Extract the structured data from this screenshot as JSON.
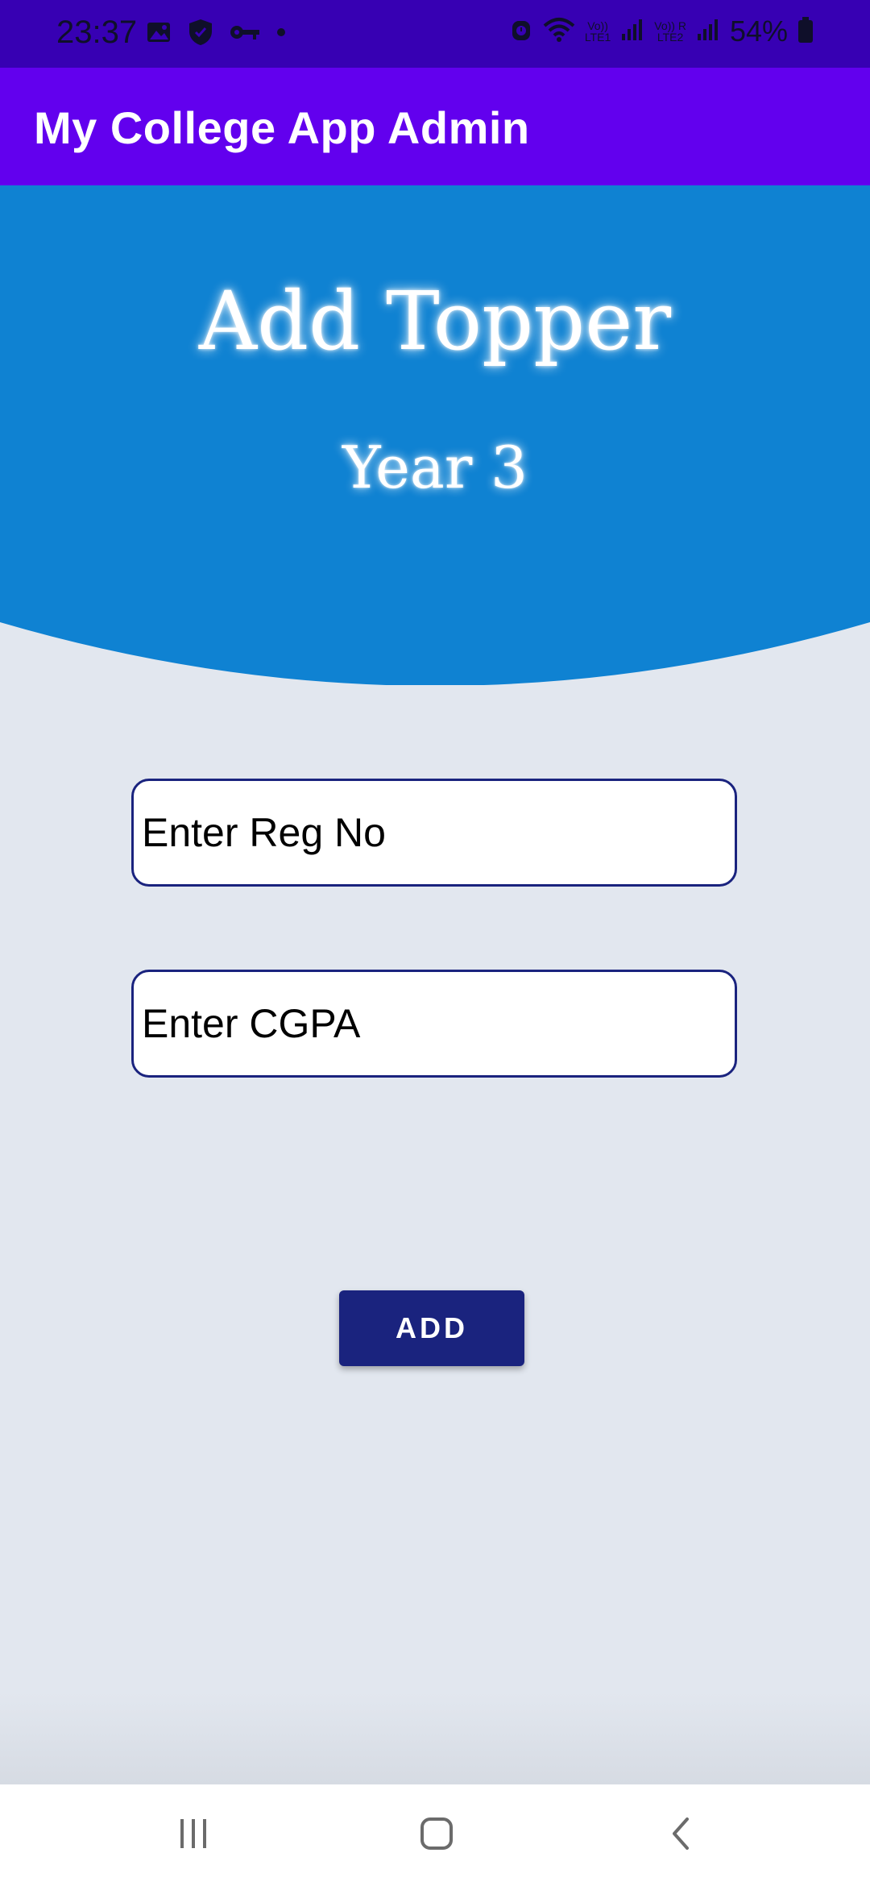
{
  "status_bar": {
    "time": "23:37",
    "battery_percent": "54%",
    "sim1_label": "Vo))\nLTE1",
    "sim2_label": "Vo)) R\nLTE2",
    "icons": [
      "gallery-icon",
      "shield-icon",
      "key-icon",
      "dot-icon",
      "alarm-icon",
      "wifi-icon",
      "signal-icon",
      "battery-icon"
    ]
  },
  "app_bar": {
    "title": "My College App Admin"
  },
  "header": {
    "title": "Add Topper",
    "subtitle": "Year 3"
  },
  "form": {
    "reg_no_placeholder": "Enter Reg No",
    "cgpa_placeholder": "Enter CGPA",
    "add_button_label": "ADD"
  },
  "nav": {
    "icons": [
      "recents-icon",
      "home-icon",
      "back-icon"
    ]
  },
  "colors": {
    "status_bar": "#3700b3",
    "app_bar": "#6200ee",
    "header_blue": "#0f82d2",
    "background": "#e2e7ef",
    "button": "#1a237e",
    "input_border": "#1a237e"
  }
}
